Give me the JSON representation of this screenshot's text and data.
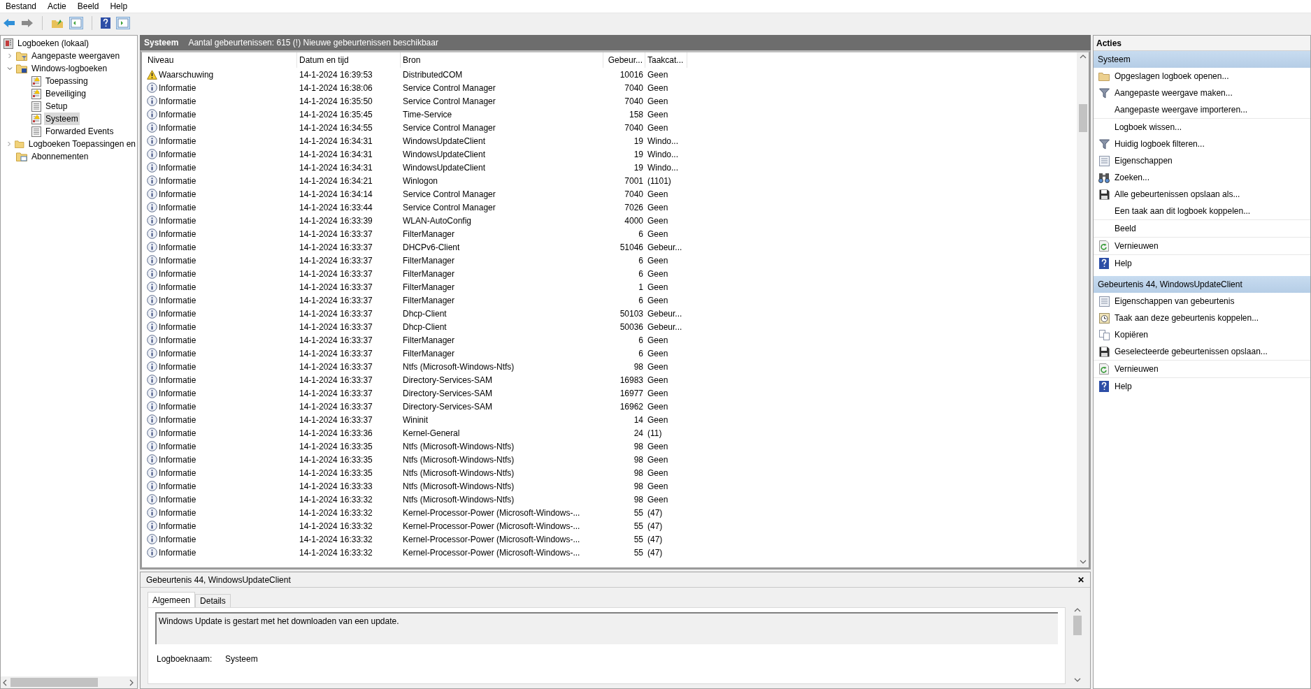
{
  "menu": [
    "Bestand",
    "Actie",
    "Beeld",
    "Help"
  ],
  "toolbar": [
    {
      "kind": "back"
    },
    {
      "kind": "forward"
    },
    {
      "kind": "sep"
    },
    {
      "kind": "up"
    },
    {
      "kind": "tree"
    },
    {
      "kind": "sep"
    },
    {
      "kind": "help"
    },
    {
      "kind": "pane"
    }
  ],
  "tree": [
    {
      "label": "Logboeken (lokaal)",
      "kind": "logs",
      "selected": false,
      "children": [
        {
          "label": "Aangepaste weergaven",
          "kind": "folder-filter",
          "selected": false,
          "expanded": false
        },
        {
          "label": "Windows-logboeken",
          "kind": "folder-pc",
          "selected": false,
          "expanded": true,
          "children": [
            {
              "label": "Toepassing",
              "kind": "log-warn",
              "selected": false
            },
            {
              "label": "Beveiliging",
              "kind": "log-warn",
              "selected": false
            },
            {
              "label": "Setup",
              "kind": "log",
              "selected": false
            },
            {
              "label": "Systeem",
              "kind": "log-warn",
              "selected": true
            },
            {
              "label": "Forwarded Events",
              "kind": "log",
              "selected": false
            }
          ]
        },
        {
          "label": "Logboeken Toepassingen en",
          "kind": "folder",
          "selected": false,
          "expanded": false
        },
        {
          "label": "Abonnementen",
          "kind": "folder-sub",
          "selected": false
        }
      ]
    }
  ],
  "log_header": {
    "title": "Systeem",
    "summary": "Aantal gebeurtenissen: 615 (!) Nieuwe gebeurtenissen beschikbaar"
  },
  "table": {
    "columns": [
      "Niveau",
      "Datum en tijd",
      "Bron",
      "Gebeur...",
      "Taakcat..."
    ],
    "rows": [
      {
        "kind": "warning",
        "level_text": "Waarschuwing",
        "time": "14-1-2024 16:39:53",
        "source": "DistributedCOM",
        "id": "10016",
        "task": "Geen"
      },
      {
        "kind": "info",
        "level_text": "Informatie",
        "time": "14-1-2024 16:38:06",
        "source": "Service Control Manager",
        "id": "7040",
        "task": "Geen"
      },
      {
        "kind": "info",
        "level_text": "Informatie",
        "time": "14-1-2024 16:35:50",
        "source": "Service Control Manager",
        "id": "7040",
        "task": "Geen"
      },
      {
        "kind": "info",
        "level_text": "Informatie",
        "time": "14-1-2024 16:35:45",
        "source": "Time-Service",
        "id": "158",
        "task": "Geen"
      },
      {
        "kind": "info",
        "level_text": "Informatie",
        "time": "14-1-2024 16:34:55",
        "source": "Service Control Manager",
        "id": "7040",
        "task": "Geen"
      },
      {
        "kind": "info",
        "level_text": "Informatie",
        "time": "14-1-2024 16:34:31",
        "source": "WindowsUpdateClient",
        "id": "19",
        "task": "Windo..."
      },
      {
        "kind": "info",
        "level_text": "Informatie",
        "time": "14-1-2024 16:34:31",
        "source": "WindowsUpdateClient",
        "id": "19",
        "task": "Windo..."
      },
      {
        "kind": "info",
        "level_text": "Informatie",
        "time": "14-1-2024 16:34:31",
        "source": "WindowsUpdateClient",
        "id": "19",
        "task": "Windo..."
      },
      {
        "kind": "info",
        "level_text": "Informatie",
        "time": "14-1-2024 16:34:21",
        "source": "Winlogon",
        "id": "7001",
        "task": "(1101)"
      },
      {
        "kind": "info",
        "level_text": "Informatie",
        "time": "14-1-2024 16:34:14",
        "source": "Service Control Manager",
        "id": "7040",
        "task": "Geen"
      },
      {
        "kind": "info",
        "level_text": "Informatie",
        "time": "14-1-2024 16:33:44",
        "source": "Service Control Manager",
        "id": "7026",
        "task": "Geen"
      },
      {
        "kind": "info",
        "level_text": "Informatie",
        "time": "14-1-2024 16:33:39",
        "source": "WLAN-AutoConfig",
        "id": "4000",
        "task": "Geen"
      },
      {
        "kind": "info",
        "level_text": "Informatie",
        "time": "14-1-2024 16:33:37",
        "source": "FilterManager",
        "id": "6",
        "task": "Geen"
      },
      {
        "kind": "info",
        "level_text": "Informatie",
        "time": "14-1-2024 16:33:37",
        "source": "DHCPv6-Client",
        "id": "51046",
        "task": "Gebeur..."
      },
      {
        "kind": "info",
        "level_text": "Informatie",
        "time": "14-1-2024 16:33:37",
        "source": "FilterManager",
        "id": "6",
        "task": "Geen"
      },
      {
        "kind": "info",
        "level_text": "Informatie",
        "time": "14-1-2024 16:33:37",
        "source": "FilterManager",
        "id": "6",
        "task": "Geen"
      },
      {
        "kind": "info",
        "level_text": "Informatie",
        "time": "14-1-2024 16:33:37",
        "source": "FilterManager",
        "id": "1",
        "task": "Geen"
      },
      {
        "kind": "info",
        "level_text": "Informatie",
        "time": "14-1-2024 16:33:37",
        "source": "FilterManager",
        "id": "6",
        "task": "Geen"
      },
      {
        "kind": "info",
        "level_text": "Informatie",
        "time": "14-1-2024 16:33:37",
        "source": "Dhcp-Client",
        "id": "50103",
        "task": "Gebeur..."
      },
      {
        "kind": "info",
        "level_text": "Informatie",
        "time": "14-1-2024 16:33:37",
        "source": "Dhcp-Client",
        "id": "50036",
        "task": "Gebeur..."
      },
      {
        "kind": "info",
        "level_text": "Informatie",
        "time": "14-1-2024 16:33:37",
        "source": "FilterManager",
        "id": "6",
        "task": "Geen"
      },
      {
        "kind": "info",
        "level_text": "Informatie",
        "time": "14-1-2024 16:33:37",
        "source": "FilterManager",
        "id": "6",
        "task": "Geen"
      },
      {
        "kind": "info",
        "level_text": "Informatie",
        "time": "14-1-2024 16:33:37",
        "source": "Ntfs (Microsoft-Windows-Ntfs)",
        "id": "98",
        "task": "Geen"
      },
      {
        "kind": "info",
        "level_text": "Informatie",
        "time": "14-1-2024 16:33:37",
        "source": "Directory-Services-SAM",
        "id": "16983",
        "task": "Geen"
      },
      {
        "kind": "info",
        "level_text": "Informatie",
        "time": "14-1-2024 16:33:37",
        "source": "Directory-Services-SAM",
        "id": "16977",
        "task": "Geen"
      },
      {
        "kind": "info",
        "level_text": "Informatie",
        "time": "14-1-2024 16:33:37",
        "source": "Directory-Services-SAM",
        "id": "16962",
        "task": "Geen"
      },
      {
        "kind": "info",
        "level_text": "Informatie",
        "time": "14-1-2024 16:33:37",
        "source": "Wininit",
        "id": "14",
        "task": "Geen"
      },
      {
        "kind": "info",
        "level_text": "Informatie",
        "time": "14-1-2024 16:33:36",
        "source": "Kernel-General",
        "id": "24",
        "task": "(11)"
      },
      {
        "kind": "info",
        "level_text": "Informatie",
        "time": "14-1-2024 16:33:35",
        "source": "Ntfs (Microsoft-Windows-Ntfs)",
        "id": "98",
        "task": "Geen"
      },
      {
        "kind": "info",
        "level_text": "Informatie",
        "time": "14-1-2024 16:33:35",
        "source": "Ntfs (Microsoft-Windows-Ntfs)",
        "id": "98",
        "task": "Geen"
      },
      {
        "kind": "info",
        "level_text": "Informatie",
        "time": "14-1-2024 16:33:35",
        "source": "Ntfs (Microsoft-Windows-Ntfs)",
        "id": "98",
        "task": "Geen"
      },
      {
        "kind": "info",
        "level_text": "Informatie",
        "time": "14-1-2024 16:33:33",
        "source": "Ntfs (Microsoft-Windows-Ntfs)",
        "id": "98",
        "task": "Geen"
      },
      {
        "kind": "info",
        "level_text": "Informatie",
        "time": "14-1-2024 16:33:32",
        "source": "Ntfs (Microsoft-Windows-Ntfs)",
        "id": "98",
        "task": "Geen"
      },
      {
        "kind": "info",
        "level_text": "Informatie",
        "time": "14-1-2024 16:33:32",
        "source": "Kernel-Processor-Power (Microsoft-Windows-...",
        "id": "55",
        "task": "(47)"
      },
      {
        "kind": "info",
        "level_text": "Informatie",
        "time": "14-1-2024 16:33:32",
        "source": "Kernel-Processor-Power (Microsoft-Windows-...",
        "id": "55",
        "task": "(47)"
      },
      {
        "kind": "info",
        "level_text": "Informatie",
        "time": "14-1-2024 16:33:32",
        "source": "Kernel-Processor-Power (Microsoft-Windows-...",
        "id": "55",
        "task": "(47)"
      },
      {
        "kind": "info",
        "level_text": "Informatie",
        "time": "14-1-2024 16:33:32",
        "source": "Kernel-Processor-Power (Microsoft-Windows-...",
        "id": "55",
        "task": "(47)"
      }
    ]
  },
  "detail": {
    "title": "Gebeurtenis 44, WindowsUpdateClient",
    "close": "✕",
    "tabs": [
      {
        "label": "Algemeen",
        "selected": true
      },
      {
        "label": "Details",
        "selected": false
      }
    ],
    "message": "Windows Update is gestart met het downloaden van een update.",
    "fields": [
      {
        "label": "Logboeknaam:",
        "value": "Systeem"
      }
    ]
  },
  "actions": {
    "title": "Acties",
    "sections": [
      {
        "title": "Systeem",
        "groups": [
          [
            {
              "label": "Opgeslagen logboek openen...",
              "kind": "folder"
            },
            {
              "label": "Aangepaste weergave maken...",
              "kind": "filter"
            },
            {
              "label": "Aangepaste weergave importeren...",
              "kind": "plain"
            }
          ],
          [
            {
              "label": "Logboek wissen...",
              "kind": "plain"
            },
            {
              "label": "Huidig logboek filteren...",
              "kind": "filter"
            },
            {
              "label": "Eigenschappen",
              "kind": "properties"
            },
            {
              "label": "Zoeken...",
              "kind": "binoculars"
            },
            {
              "label": "Alle gebeurtenissen opslaan als...",
              "kind": "save"
            },
            {
              "label": "Een taak aan dit logboek koppelen...",
              "kind": "plain"
            }
          ],
          [
            {
              "label": "Beeld",
              "kind": "plain"
            }
          ],
          [
            {
              "label": "Vernieuwen",
              "kind": "refresh"
            }
          ],
          [
            {
              "label": "Help",
              "kind": "help"
            }
          ]
        ]
      },
      {
        "title": "Gebeurtenis 44, WindowsUpdateClient",
        "groups": [
          [
            {
              "label": "Eigenschappen van gebeurtenis",
              "kind": "properties"
            },
            {
              "label": "Taak aan deze gebeurtenis koppelen...",
              "kind": "clock"
            },
            {
              "label": "Kopiëren",
              "kind": "copy"
            },
            {
              "label": "Geselecteerde gebeurtenissen opslaan...",
              "kind": "save"
            }
          ],
          [
            {
              "label": "Vernieuwen",
              "kind": "refresh"
            }
          ],
          [
            {
              "label": "Help",
              "kind": "help"
            }
          ]
        ]
      }
    ]
  }
}
